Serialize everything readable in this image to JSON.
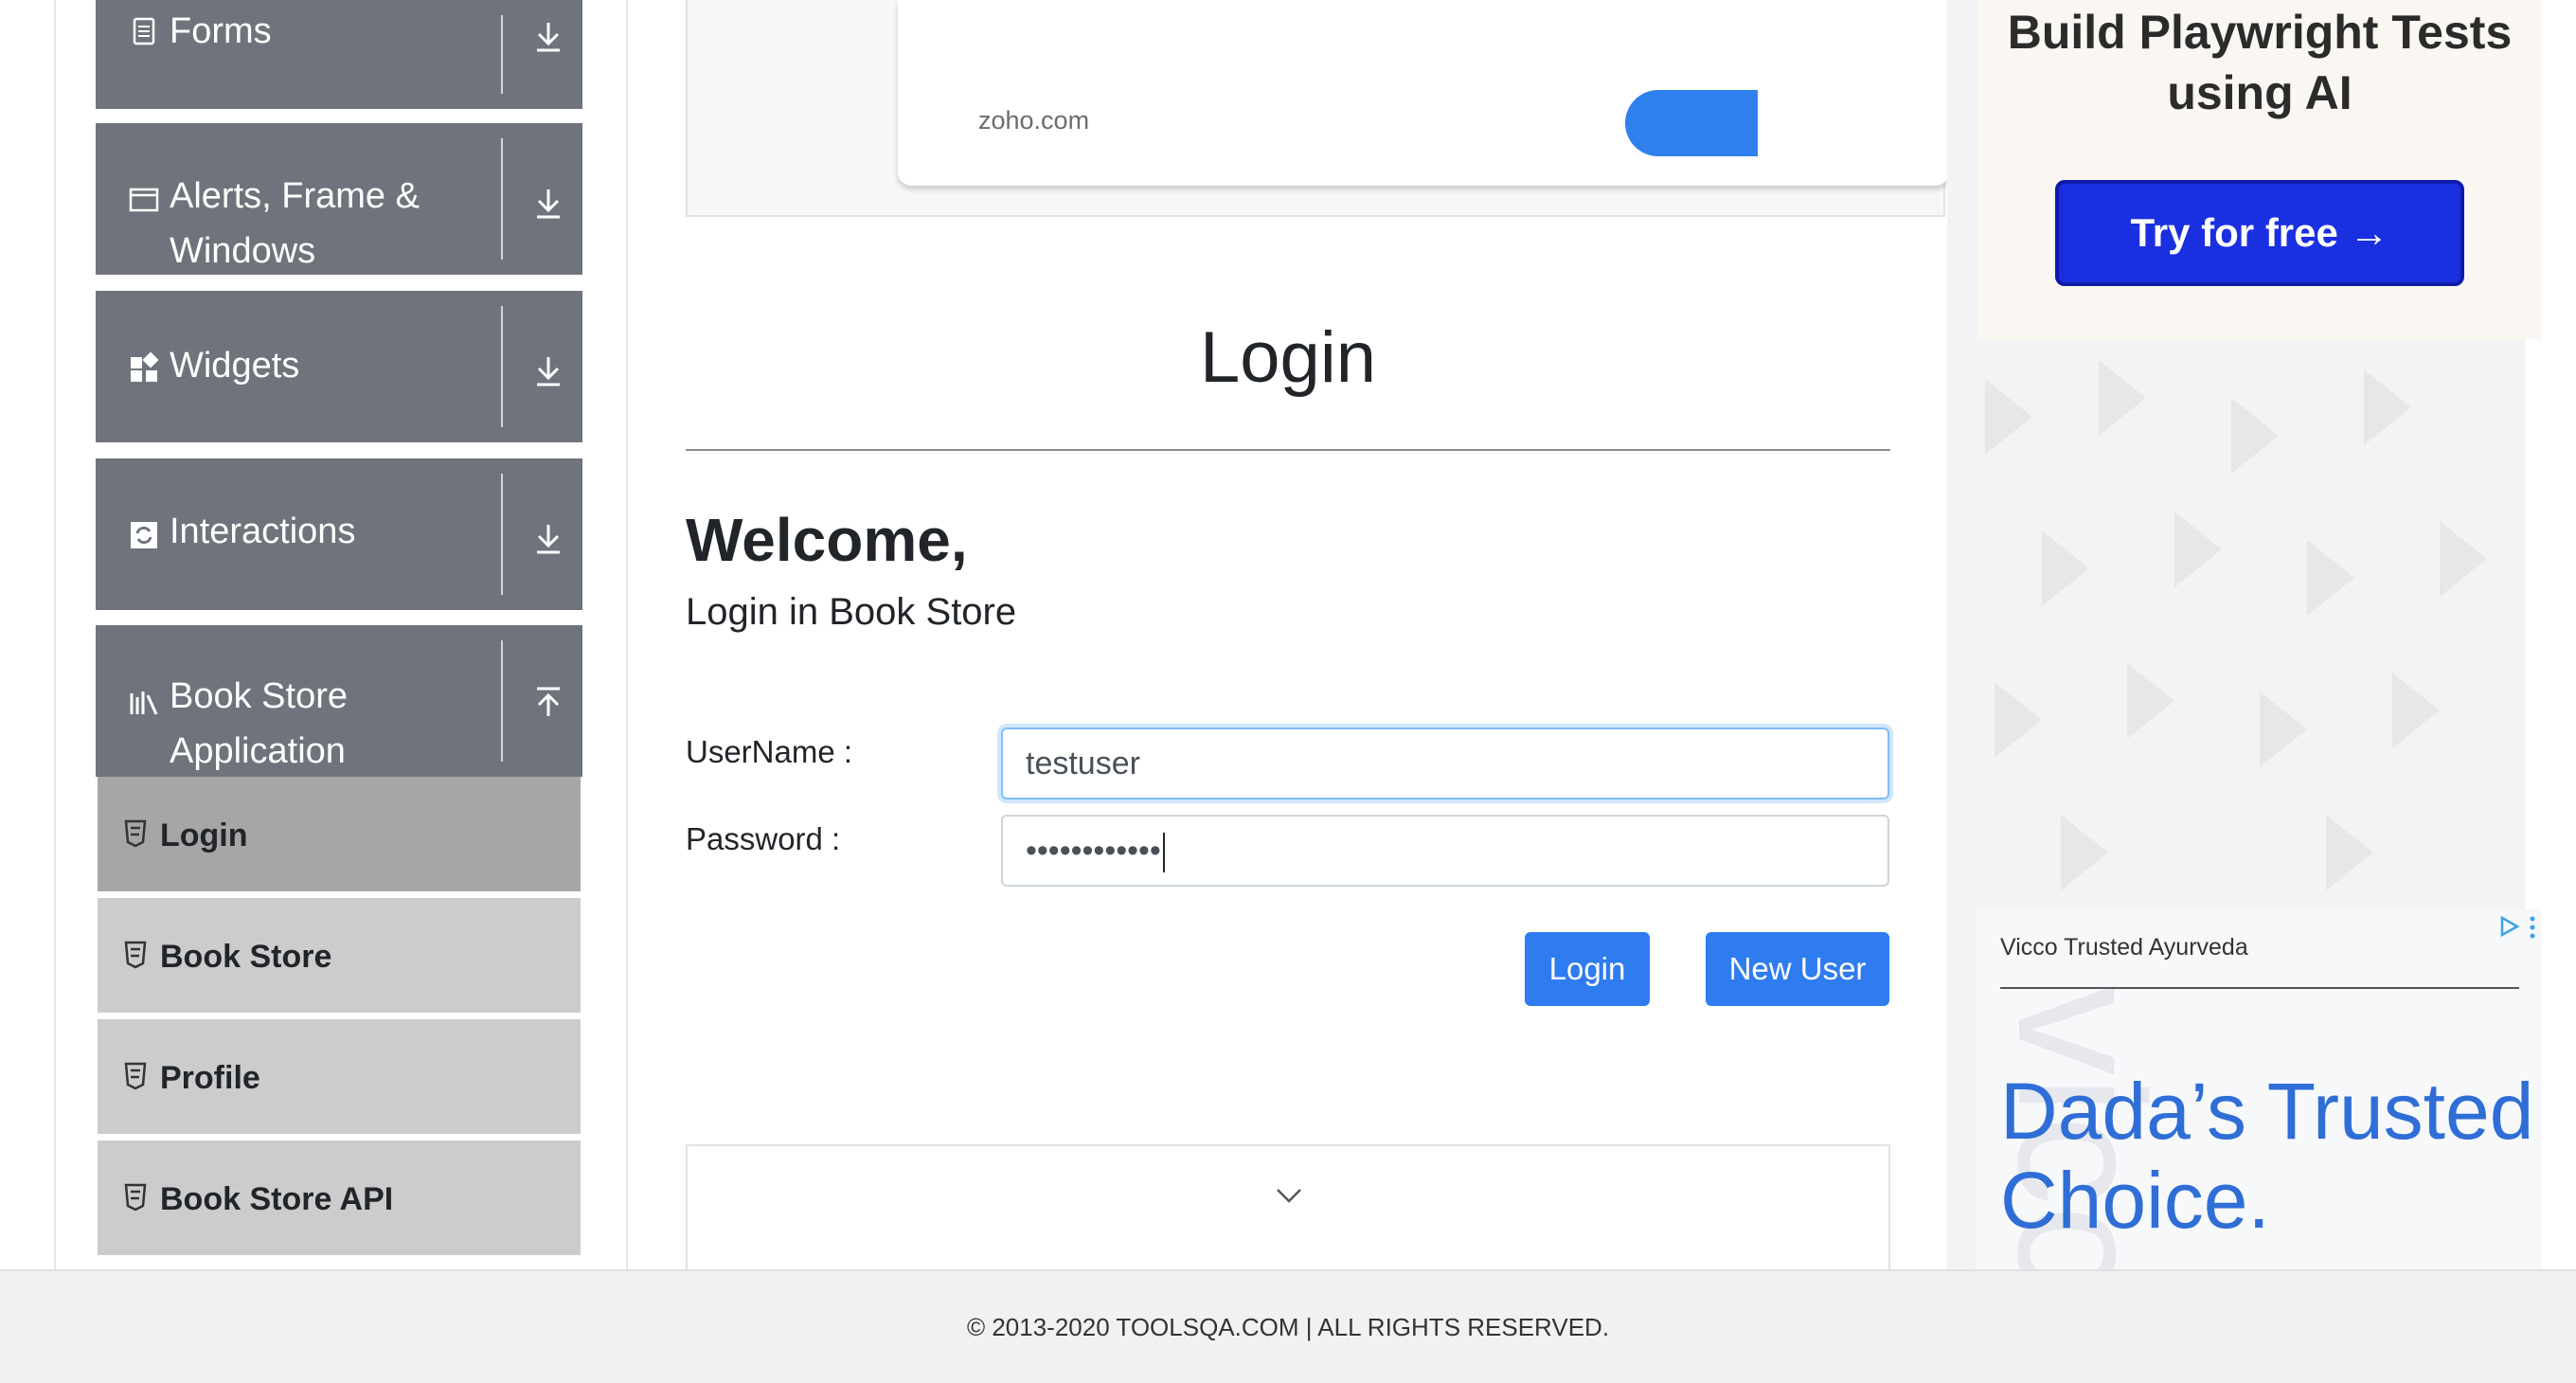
{
  "sidebar": {
    "groups": [
      {
        "label": "Forms",
        "icon": "document-icon",
        "toggle": "download-arrow-icon"
      },
      {
        "label": "Alerts, Frame & Windows",
        "icon": "window-icon",
        "toggle": "download-arrow-icon"
      },
      {
        "label": "Widgets",
        "icon": "widgets-icon",
        "toggle": "download-arrow-icon"
      },
      {
        "label": "Interactions",
        "icon": "interactions-icon",
        "toggle": "download-arrow-icon"
      },
      {
        "label": "Book Store Application",
        "icon": "library-icon",
        "toggle": "upload-arrow-icon",
        "expanded": true
      }
    ],
    "book_store_items": [
      {
        "label": "Login",
        "active": true
      },
      {
        "label": "Book Store",
        "active": false
      },
      {
        "label": "Profile",
        "active": false
      },
      {
        "label": "Book Store API",
        "active": false
      }
    ]
  },
  "top_ad": {
    "domain": "zoho.com"
  },
  "main": {
    "header": "Login",
    "welcome": "Welcome,",
    "subtitle": "Login in Book Store",
    "username_label": "UserName :",
    "username_value": "testuser",
    "password_label": "Password :",
    "password_value": "••••••••••••",
    "login_button": "Login",
    "new_user_button": "New User"
  },
  "right_ads": {
    "ad1_title": "Build Playwright Tests using AI",
    "ad1_button": "Try for free →",
    "ad2_brand": "Vicco Trusted Ayurveda",
    "ad2_headline": "Dada’s Trusted Choice.",
    "ad2_watermark": "vicco"
  },
  "footer": {
    "text": "© 2013-2020 TOOLSQA.COM | ALL RIGHTS RESERVED."
  },
  "colors": {
    "sidebar_group": "#6f747c",
    "submenu": "#cccccc",
    "submenu_active": "#a6a6a6",
    "primary_button": "#2f7cf0",
    "ad_button": "#1a2fe0",
    "ad_headline": "#2f6ed6"
  }
}
